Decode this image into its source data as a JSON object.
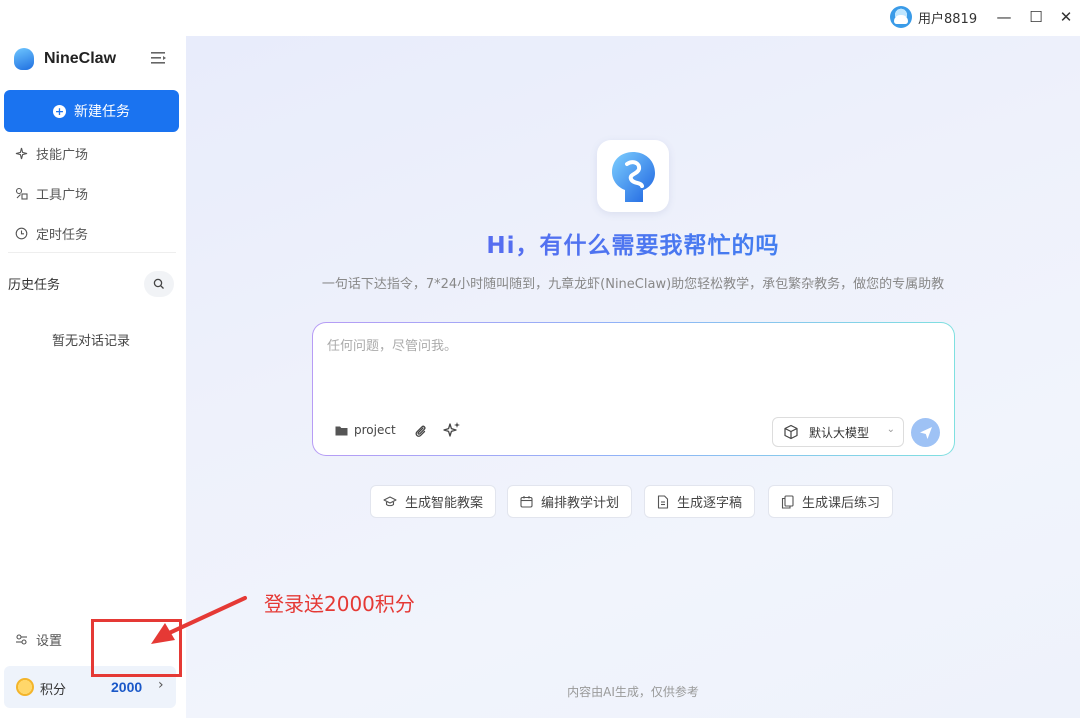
{
  "titlebar": {
    "username": "用户8819",
    "minimize": "—",
    "maximize": "☐",
    "close": "✕"
  },
  "sidebar": {
    "app_name": "NineClaw",
    "new_task": "新建任务",
    "nav": [
      {
        "label": "技能广场",
        "icon": "sparkle-icon"
      },
      {
        "label": "工具广场",
        "icon": "tools-icon"
      },
      {
        "label": "定时任务",
        "icon": "clock-icon"
      }
    ],
    "history_title": "历史任务",
    "no_history": "暂无对话记录",
    "settings": "设置",
    "points_label": "积分",
    "points_value": "2000"
  },
  "main": {
    "title": "Hi，有什么需要我帮忙的吗",
    "subtitle": "一句话下达指令，7*24小时随叫随到，九章龙虾(NineClaw)助您轻松教学，承包繁杂教务，做您的专属助教",
    "input_placeholder": "任何问题，尽管问我。",
    "project_label": "project",
    "model_label": "默认大模型",
    "quick_actions": [
      {
        "label": "生成智能教案",
        "icon": "graduation-cap-icon"
      },
      {
        "label": "编排教学计划",
        "icon": "calendar-icon"
      },
      {
        "label": "生成逐字稿",
        "icon": "document-icon"
      },
      {
        "label": "生成课后练习",
        "icon": "copy-icon"
      }
    ],
    "footer": "内容由AI生成，仅供参考"
  },
  "annotation": {
    "text": "登录送2000积分",
    "color": "#e53935"
  },
  "colors": {
    "accent": "#1a73f0",
    "points_value": "#1a58c8"
  }
}
